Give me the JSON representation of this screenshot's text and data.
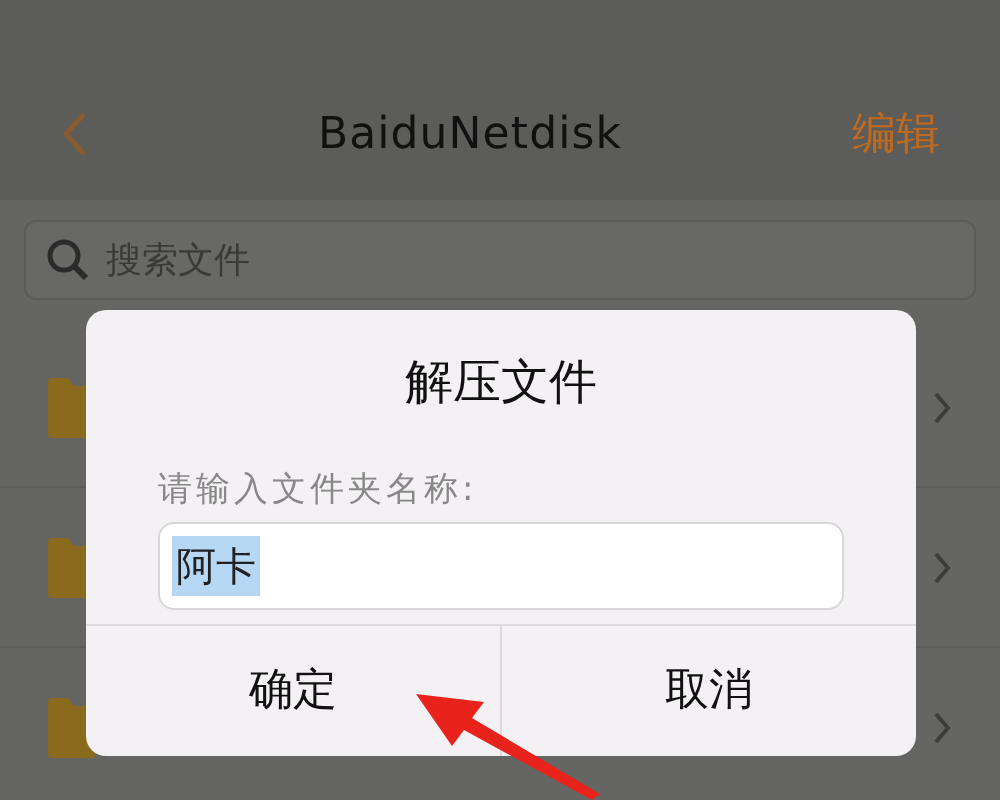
{
  "nav_bar": {
    "title": "BaiduNetdisk",
    "edit": "编辑"
  },
  "search": {
    "placeholder": "搜索文件"
  },
  "file_rows": [
    {
      "kind": "folder"
    },
    {
      "kind": "folder"
    },
    {
      "kind": "folder"
    }
  ],
  "dialog": {
    "title": "解压文件",
    "prompt": "请输入文件夹名称:",
    "field": {
      "value": "阿卡",
      "value_selected": true
    },
    "buttons": [
      {
        "label": "确定"
      },
      {
        "label": "取消"
      }
    ]
  },
  "annotation": {
    "kind": "arrow"
  }
}
